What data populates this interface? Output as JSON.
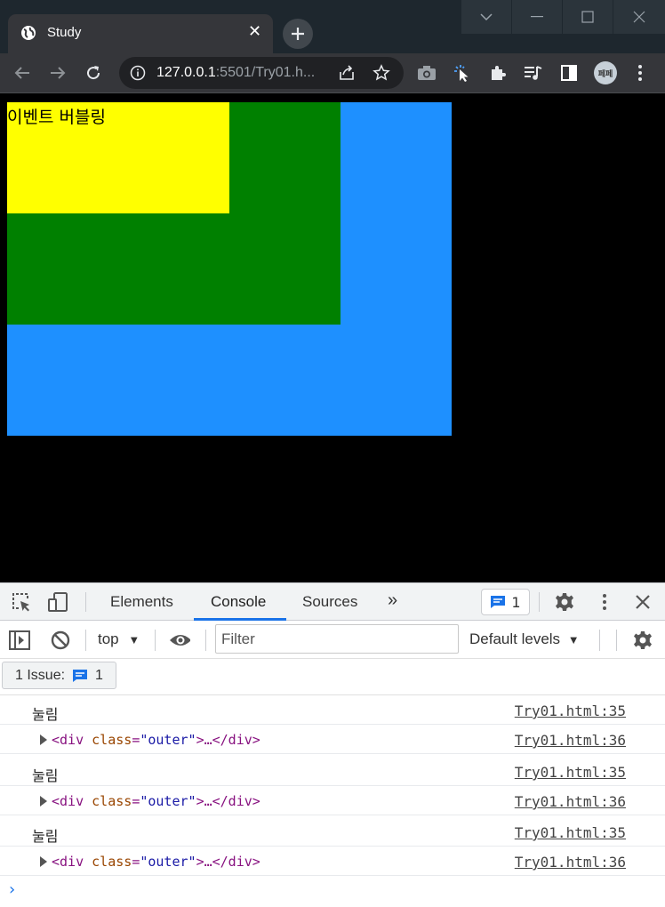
{
  "browser": {
    "tab_title": "Study",
    "tab_close": "✕",
    "new_tab": "+",
    "url_host": "127.0.0.1",
    "url_rest": ":5501/Try01.h...",
    "profile": "페페"
  },
  "page": {
    "inner_text": "이벤트 버블링",
    "colors": {
      "outer": "#1e90ff",
      "middle": "#008000",
      "inner": "#ffff00"
    }
  },
  "devtools": {
    "tabs": [
      "Elements",
      "Console",
      "Sources"
    ],
    "more_tabs": "»",
    "issues_count": "1",
    "context": "top",
    "filter_placeholder": "Filter",
    "levels": "Default levels",
    "issue_label": "1 Issue:",
    "issue_count": "1",
    "logs": [
      {
        "kind": "text",
        "text": "눌림",
        "source": "Try01.html:35"
      },
      {
        "kind": "element",
        "open": "<div ",
        "attr": "class",
        "eq": "=",
        "val": "\"outer\"",
        "rest": ">…</div>",
        "source": "Try01.html:36"
      },
      {
        "kind": "text",
        "text": "눌림",
        "source": "Try01.html:35"
      },
      {
        "kind": "element",
        "open": "<div ",
        "attr": "class",
        "eq": "=",
        "val": "\"outer\"",
        "rest": ">…</div>",
        "source": "Try01.html:36"
      },
      {
        "kind": "text",
        "text": "눌림",
        "source": "Try01.html:35"
      },
      {
        "kind": "element",
        "open": "<div ",
        "attr": "class",
        "eq": "=",
        "val": "\"outer\"",
        "rest": ">…</div>",
        "source": "Try01.html:36"
      }
    ],
    "prompt": "›"
  }
}
